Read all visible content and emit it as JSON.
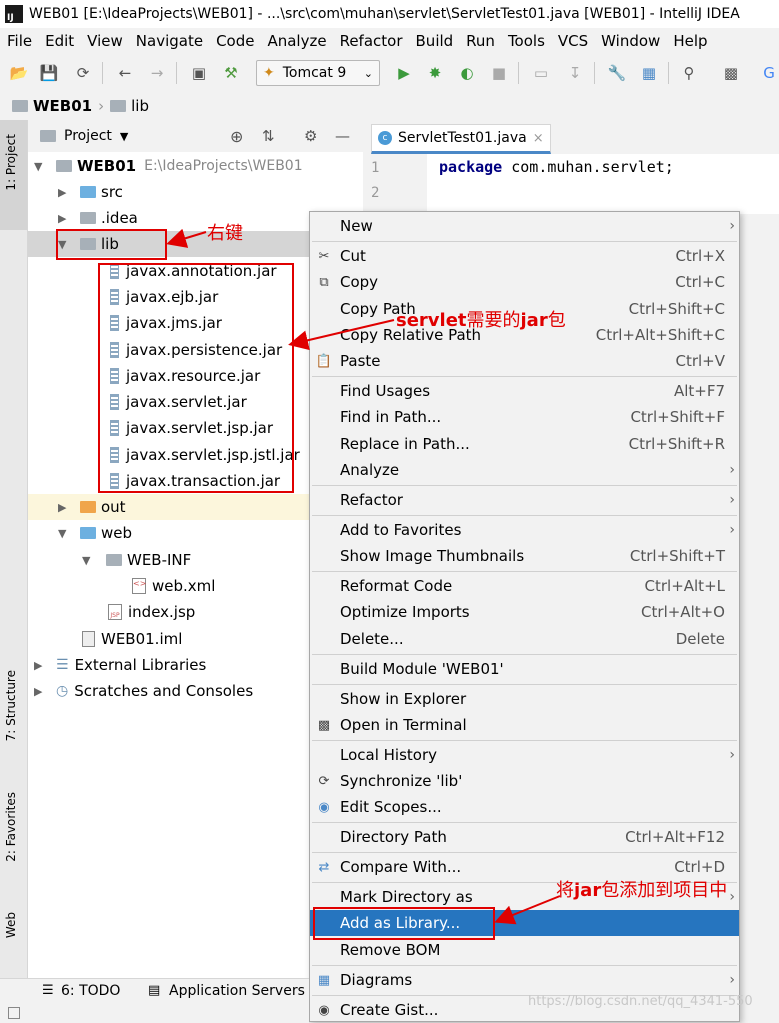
{
  "window": {
    "title": "WEB01 [E:\\IdeaProjects\\WEB01] - ...\\src\\com\\muhan\\servlet\\ServletTest01.java [WEB01] - IntelliJ IDEA"
  },
  "menu": [
    "File",
    "Edit",
    "View",
    "Navigate",
    "Code",
    "Analyze",
    "Refactor",
    "Build",
    "Run",
    "Tools",
    "VCS",
    "Window",
    "Help"
  ],
  "toolbar": {
    "run_config": "Tomcat 9"
  },
  "breadcrumb": {
    "project": "WEB01",
    "folder": "lib"
  },
  "project_panel": {
    "title": "Project"
  },
  "tree": {
    "root_name": "WEB01",
    "root_path": "E:\\IdeaProjects\\WEB01",
    "src": "src",
    "idea": ".idea",
    "lib": "lib",
    "jars": [
      "javax.annotation.jar",
      "javax.ejb.jar",
      "javax.jms.jar",
      "javax.persistence.jar",
      "javax.resource.jar",
      "javax.servlet.jar",
      "javax.servlet.jsp.jar",
      "javax.servlet.jsp.jstl.jar",
      "javax.transaction.jar"
    ],
    "out": "out",
    "web": "web",
    "webinf": "WEB-INF",
    "webxml": "web.xml",
    "indexjsp": "index.jsp",
    "iml": "WEB01.iml",
    "ext_libs": "External Libraries",
    "scratches": "Scratches and Consoles"
  },
  "editor": {
    "tab": "ServletTest01.java",
    "line1_num": "1",
    "line2_num": "2",
    "line1_kw": "package",
    "line1_rest": " com.muhan.servlet;"
  },
  "context_menu": {
    "new": "New",
    "cut": "Cut",
    "cut_sc": "Ctrl+X",
    "copy": "Copy",
    "copy_sc": "Ctrl+C",
    "copy_path": "Copy Path",
    "copy_path_sc": "Ctrl+Shift+C",
    "copy_rel": "Copy Relative Path",
    "copy_rel_sc": "Ctrl+Alt+Shift+C",
    "paste": "Paste",
    "paste_sc": "Ctrl+V",
    "find_usages": "Find Usages",
    "find_usages_sc": "Alt+F7",
    "find_path": "Find in Path...",
    "find_path_sc": "Ctrl+Shift+F",
    "replace_path": "Replace in Path...",
    "replace_path_sc": "Ctrl+Shift+R",
    "analyze": "Analyze",
    "refactor": "Refactor",
    "add_fav": "Add to Favorites",
    "thumbs": "Show Image Thumbnails",
    "thumbs_sc": "Ctrl+Shift+T",
    "reformat": "Reformat Code",
    "reformat_sc": "Ctrl+Alt+L",
    "optimize": "Optimize Imports",
    "optimize_sc": "Ctrl+Alt+O",
    "delete": "Delete...",
    "delete_sc": "Delete",
    "build_module": "Build Module 'WEB01'",
    "explorer": "Show in Explorer",
    "terminal": "Open in Terminal",
    "local_history": "Local History",
    "sync": "Synchronize 'lib'",
    "edit_scopes": "Edit Scopes...",
    "dir_path": "Directory Path",
    "dir_path_sc": "Ctrl+Alt+F12",
    "compare": "Compare With...",
    "compare_sc": "Ctrl+D",
    "mark_dir": "Mark Directory as",
    "add_lib": "Add as Library...",
    "remove_bom": "Remove BOM",
    "diagrams": "Diagrams",
    "gist": "Create Gist..."
  },
  "side_tabs": {
    "project": "1: Project",
    "structure": "7: Structure",
    "favorites": "2: Favorites",
    "web": "Web"
  },
  "bottom": {
    "todo": "6: TODO",
    "app_servers": "Application Servers"
  },
  "annotations": {
    "right_click": "右键",
    "jars_needed_a": "servlet",
    "jars_needed_b": "需要的",
    "jars_needed_c": "jar",
    "jars_needed_d": "包",
    "add_lib_a": "将",
    "add_lib_b": "jar",
    "add_lib_c": "包添加到项目中"
  },
  "watermark": "https://blog.csdn.net/qq_4341-550",
  "colors": {
    "selection": "#2675bf",
    "annotation_red": "#e00000",
    "keyword": "#000080"
  }
}
